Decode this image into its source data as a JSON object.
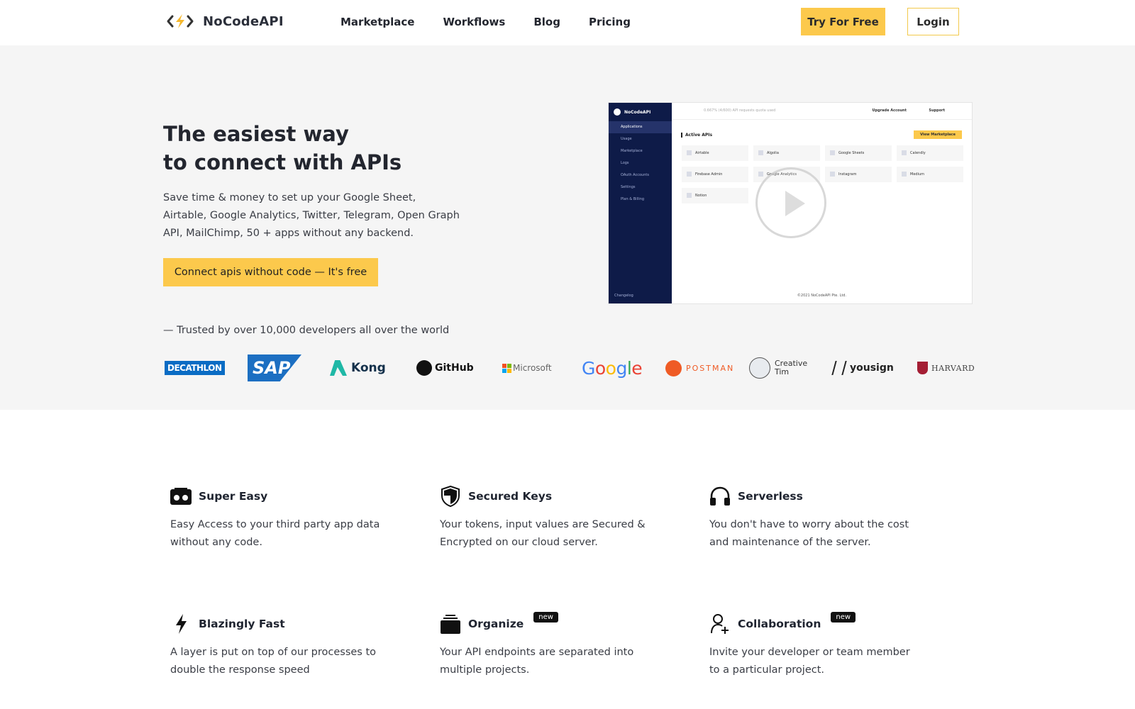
{
  "nav": {
    "brand": "NoCodeAPI",
    "links": [
      "Marketplace",
      "Workflows",
      "Blog",
      "Pricing"
    ],
    "try_label": "Try For Free",
    "login_label": "Login"
  },
  "hero": {
    "title_line1": "The easiest way",
    "title_line2": "to connect with APIs",
    "description": "Save time & money to set up your Google Sheet, Airtable, Google Analytics, Twitter, Telegram, Open Graph API, MailChimp, 50 + apps without any backend.",
    "cta_label": "Connect apis without code — It's free",
    "trusted": "— Trusted by over 10,000 developers all over the world"
  },
  "video_preview": {
    "brand": "NoCodeAPI",
    "quota_text": "0.667% (4/600) API requests quota used",
    "upgrade": "Upgrade Account",
    "support": "Support",
    "menu": [
      "Applications",
      "Usage",
      "Marketplace",
      "Logs",
      "OAuth Accounts",
      "Settings",
      "Plan & Billing"
    ],
    "changelog": "Changelog",
    "active_label": "Active APIs",
    "view_marketplace": "View Marketplace",
    "apis": [
      "Airtable",
      "Algolia",
      "Google Sheets",
      "Calendly",
      "Firebase Admin",
      "Google Analytics",
      "Instagram",
      "Medium",
      "Notion"
    ],
    "copyright": "©2021 NoCodeAPI Pte. Ltd."
  },
  "logos": {
    "decathlon": "DECATHLON",
    "sap": "SAP",
    "kong": "Kong",
    "github": "GitHub",
    "microsoft": "Microsoft",
    "google": "Google",
    "postman": "POSTMAN",
    "creative_tim_1": "Creative",
    "creative_tim_2": "Tim",
    "yousign": "yousign",
    "harvard": "HARVARD"
  },
  "features": [
    {
      "title": "Super Easy",
      "desc": "Easy Access to your third party app data without any code.",
      "icon": "cassette-icon",
      "badge": ""
    },
    {
      "title": "Secured Keys",
      "desc": "Your tokens, input values are Secured & Encrypted on our cloud server.",
      "icon": "shield-icon",
      "badge": ""
    },
    {
      "title": "Serverless",
      "desc": "You don't have to worry about the cost and maintenance of the server.",
      "icon": "headphones-icon",
      "badge": ""
    },
    {
      "title": "Blazingly Fast",
      "desc": "A layer is put on top of our processes to double the response speed",
      "icon": "bolt-icon",
      "badge": ""
    },
    {
      "title": "Organize",
      "desc": "Your API endpoints are separated into multiple projects.",
      "icon": "folder-stack-icon",
      "badge": "new"
    },
    {
      "title": "Collaboration",
      "desc": "Invite your developer or team member to a particular project.",
      "icon": "user-plus-icon",
      "badge": "new"
    }
  ],
  "colors": {
    "accent": "#fcc94c",
    "hero_bg": "#f5f5f5",
    "dashboard_sidebar": "#0e1b48"
  }
}
